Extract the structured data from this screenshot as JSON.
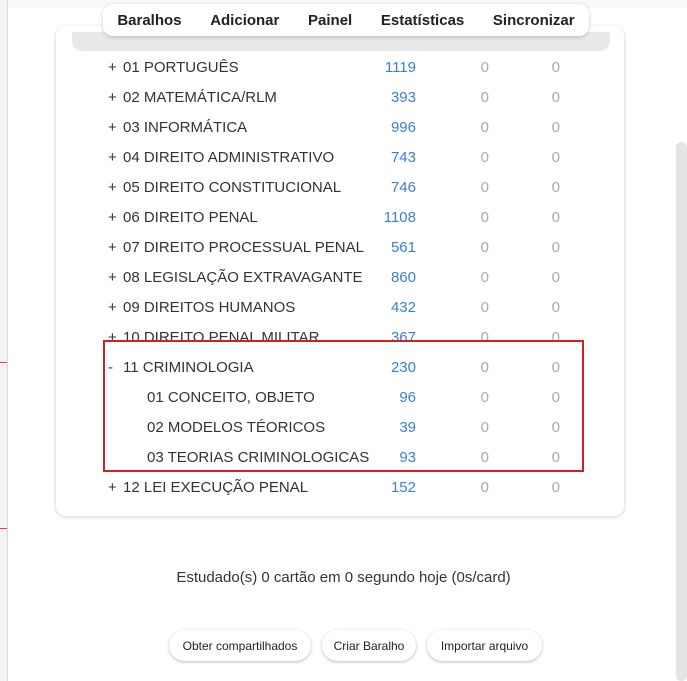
{
  "toolbar": {
    "items": [
      "Baralhos",
      "Adicionar",
      "Painel",
      "Estatísticas",
      "Sincronizar"
    ]
  },
  "deck_rows": [
    {
      "prefix": "+",
      "name": "01 PORTUGUÊS",
      "new": "1119",
      "learn": "0",
      "due": "0"
    },
    {
      "prefix": "+",
      "name": "02 MATEMÁTICA/RLM",
      "new": "393",
      "learn": "0",
      "due": "0"
    },
    {
      "prefix": "+",
      "name": "03 INFORMÁTICA",
      "new": "996",
      "learn": "0",
      "due": "0"
    },
    {
      "prefix": "+",
      "name": "04 DIREITO ADMINISTRATIVO",
      "new": "743",
      "learn": "0",
      "due": "0"
    },
    {
      "prefix": "+",
      "name": "05 DIREITO CONSTITUCIONAL",
      "new": "746",
      "learn": "0",
      "due": "0"
    },
    {
      "prefix": "+",
      "name": "06 DIREITO PENAL",
      "new": "1108",
      "learn": "0",
      "due": "0"
    },
    {
      "prefix": "+",
      "name": "07 DIREITO PROCESSUAL PENAL",
      "new": "561",
      "learn": "0",
      "due": "0"
    },
    {
      "prefix": "+",
      "name": "08 LEGISLAÇÃO EXTRAVAGANTE",
      "new": "860",
      "learn": "0",
      "due": "0"
    },
    {
      "prefix": "+",
      "name": "09 DIREITOS HUMANOS",
      "new": "432",
      "learn": "0",
      "due": "0"
    },
    {
      "prefix": "+",
      "name": "10 DIREITO PENAL MILITAR",
      "new": "367",
      "learn": "0",
      "due": "0"
    },
    {
      "prefix": "-",
      "name": "11 CRIMINOLOGIA",
      "new": "230",
      "learn": "0",
      "due": "0"
    },
    {
      "prefix": "",
      "name": "01 CONCEITO, OBJETO",
      "new": "96",
      "learn": "0",
      "due": "0"
    },
    {
      "prefix": "",
      "name": "02 MODELOS TÉORICOS",
      "new": "39",
      "learn": "0",
      "due": "0"
    },
    {
      "prefix": "",
      "name": "03 TEORIAS CRIMINOLOGICAS",
      "new": "93",
      "learn": "0",
      "due": "0"
    },
    {
      "prefix": "+",
      "name": "12 LEI EXECUÇÃO PENAL",
      "new": "152",
      "learn": "0",
      "due": "0"
    }
  ],
  "studied_text": "Estudado(s) 0 cartão em 0 segundo hoje (0s/card)",
  "buttons": [
    "Obter compartilhados",
    "Criar Baralho",
    "Importar arquivo"
  ],
  "colors": {
    "count_new": "#3b7fd1",
    "count_zero": "#aaaaaa",
    "highlight_border": "#d21f1f"
  }
}
